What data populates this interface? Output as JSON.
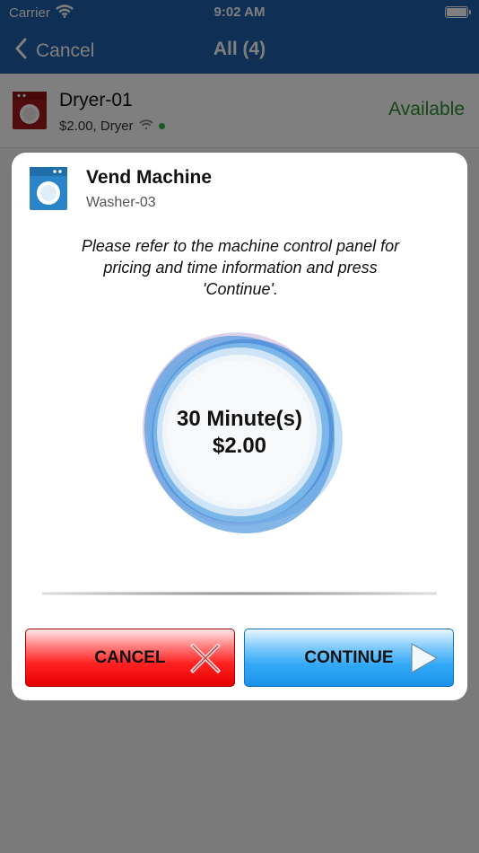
{
  "status_bar": {
    "carrier": "Carrier",
    "time": "9:02 AM"
  },
  "nav": {
    "back_label": "Cancel",
    "title": "All (4)"
  },
  "list": {
    "items": [
      {
        "name": "Dryer-01",
        "detail": "$2.00, Dryer",
        "status": "Available"
      }
    ]
  },
  "modal": {
    "title": "Vend Machine",
    "subtitle": "Washer-03",
    "message": "Please refer to the machine control panel for pricing and time information and press 'Continue'.",
    "duration": "30 Minute(s)",
    "price": "$2.00",
    "cancel_label": "CANCEL",
    "continue_label": "CONTINUE"
  },
  "colors": {
    "nav_bar": "#1f5ea8",
    "available": "#2f8f2f",
    "cancel_button": "#ff2222",
    "continue_button": "#33a9f6"
  },
  "icons": {
    "wifi": "wifi-icon",
    "battery": "battery-icon",
    "back": "chevron-left-icon",
    "dryer": "dryer-icon",
    "washer": "washer-icon",
    "cancel": "x-icon",
    "continue": "play-triangle-icon"
  }
}
